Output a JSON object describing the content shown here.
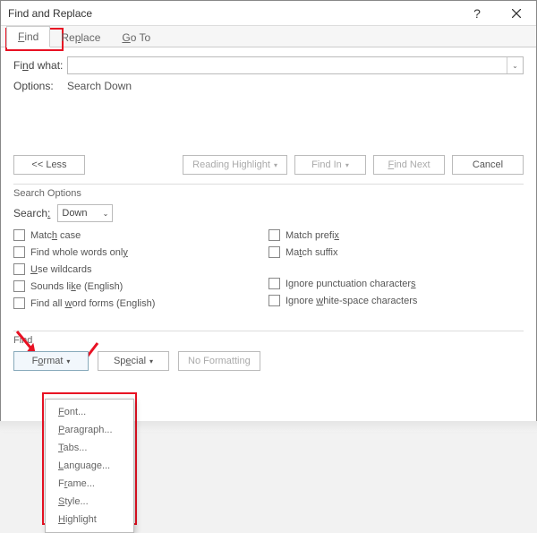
{
  "titlebar": {
    "title": "Find and Replace"
  },
  "tabs": {
    "find": "Find",
    "replace": "Replace",
    "goto": "Go To"
  },
  "labels": {
    "find_what": "Find what:",
    "options": "Options:",
    "options_value": "Search Down",
    "search_options_title": "Search Options",
    "search_label": "Search:",
    "search_value": "Down",
    "find_section": "Find"
  },
  "buttons": {
    "less": "<< Less",
    "reading_highlight": "Reading Highlight",
    "find_in": "Find In",
    "find_next": "Find Next",
    "cancel": "Cancel",
    "format": "Format",
    "special": "Special",
    "no_formatting": "No Formatting"
  },
  "checks": {
    "match_case": "Match case",
    "whole_words": "Find whole words only",
    "wildcards": "Use wildcards",
    "sounds_like": "Sounds like (English)",
    "word_forms": "Find all word forms (English)",
    "match_prefix": "Match prefix",
    "match_suffix": "Match suffix",
    "ignore_punct": "Ignore punctuation characters",
    "ignore_ws": "Ignore white-space characters"
  },
  "menu": {
    "font": "Font...",
    "paragraph": "Paragraph...",
    "tabs": "Tabs...",
    "language": "Language...",
    "frame": "Frame...",
    "style": "Style...",
    "highlight": "Highlight"
  }
}
